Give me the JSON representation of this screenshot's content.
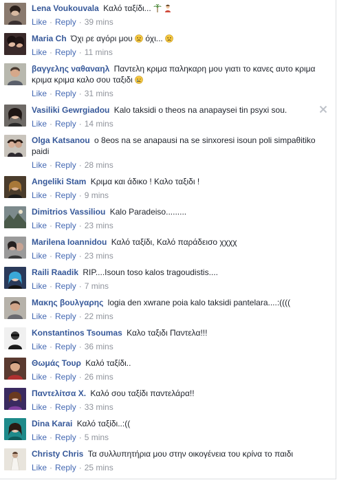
{
  "ui": {
    "like_label": "Like",
    "reply_label": "Reply",
    "separator": "·"
  },
  "comments": [
    {
      "author": "Lena Voukouvala",
      "text": "Καλό ταξίδι...",
      "time": "39 mins",
      "emoji": [
        "palm-tree-icon",
        "person-icon"
      ]
    },
    {
      "author": "Maria Ch",
      "text": "Όχι ρε αγόρι μου",
      "text2": "όχι...",
      "time": "11 mins",
      "emoji": [
        "frowning-face-icon"
      ]
    },
    {
      "author": "βαγγελης ναθαναηλ",
      "text": "Παντελη κριμα παληκαρη μου γιατι το κανες αυτο κριμα κριμα κριμα καλο σου ταξιδι",
      "time": "31 mins",
      "emoji": [
        "crying-face-icon"
      ]
    },
    {
      "author": "Vasiliki Gewrgiadou",
      "text": "Kalo taksidi o theos na anapaysei tin psyxi sou.",
      "time": "14 mins"
    },
    {
      "author": "Olga Katsanou",
      "text": "o 8eos na se anapausi na se sinxoresi isoun poli simpaθitiko paidi",
      "time": "28 mins"
    },
    {
      "author": "Angeliki Stam",
      "text": "Κριμα και άδικο ! Καλο ταξιδι !",
      "time": "9 mins"
    },
    {
      "author": "Dimitrios Vassiliou",
      "text": "Kalo Paradeiso.........",
      "time": "23 mins"
    },
    {
      "author": "Marilena Ioannidou",
      "text": "Καλό ταξίδι, Καλό παράδεισο χχχχ",
      "time": "23 mins"
    },
    {
      "author": "Raili Raadik",
      "text": "RIP....Isoun toso kalos tragoudistis....",
      "time": "7 mins"
    },
    {
      "author": "Μακης βουλγαρης",
      "text": "logia den xwrane poia kalo taksidi pantelara....:((((",
      "time": "22 mins"
    },
    {
      "author": "Konstantinos Tsoumas",
      "text": "Καλο ταξιδι Παντελα!!!",
      "time": "36 mins"
    },
    {
      "author": "Θωμάς Τουρ",
      "text": "Καλό ταξίδι..",
      "time": "26 mins"
    },
    {
      "author": "Παντελίτσα Χ.",
      "text": "Καλό σου ταξίδι παντελάρα!!",
      "time": "33 mins"
    },
    {
      "author": "Dina Karai",
      "text": "Καλό ταξίδι..:((",
      "time": "5 mins"
    },
    {
      "author": "Christy Chris",
      "text": "Τα συλλυπητήρια μου στην οικογένεια του κρίνα το παιδι",
      "time": "25 mins"
    }
  ]
}
